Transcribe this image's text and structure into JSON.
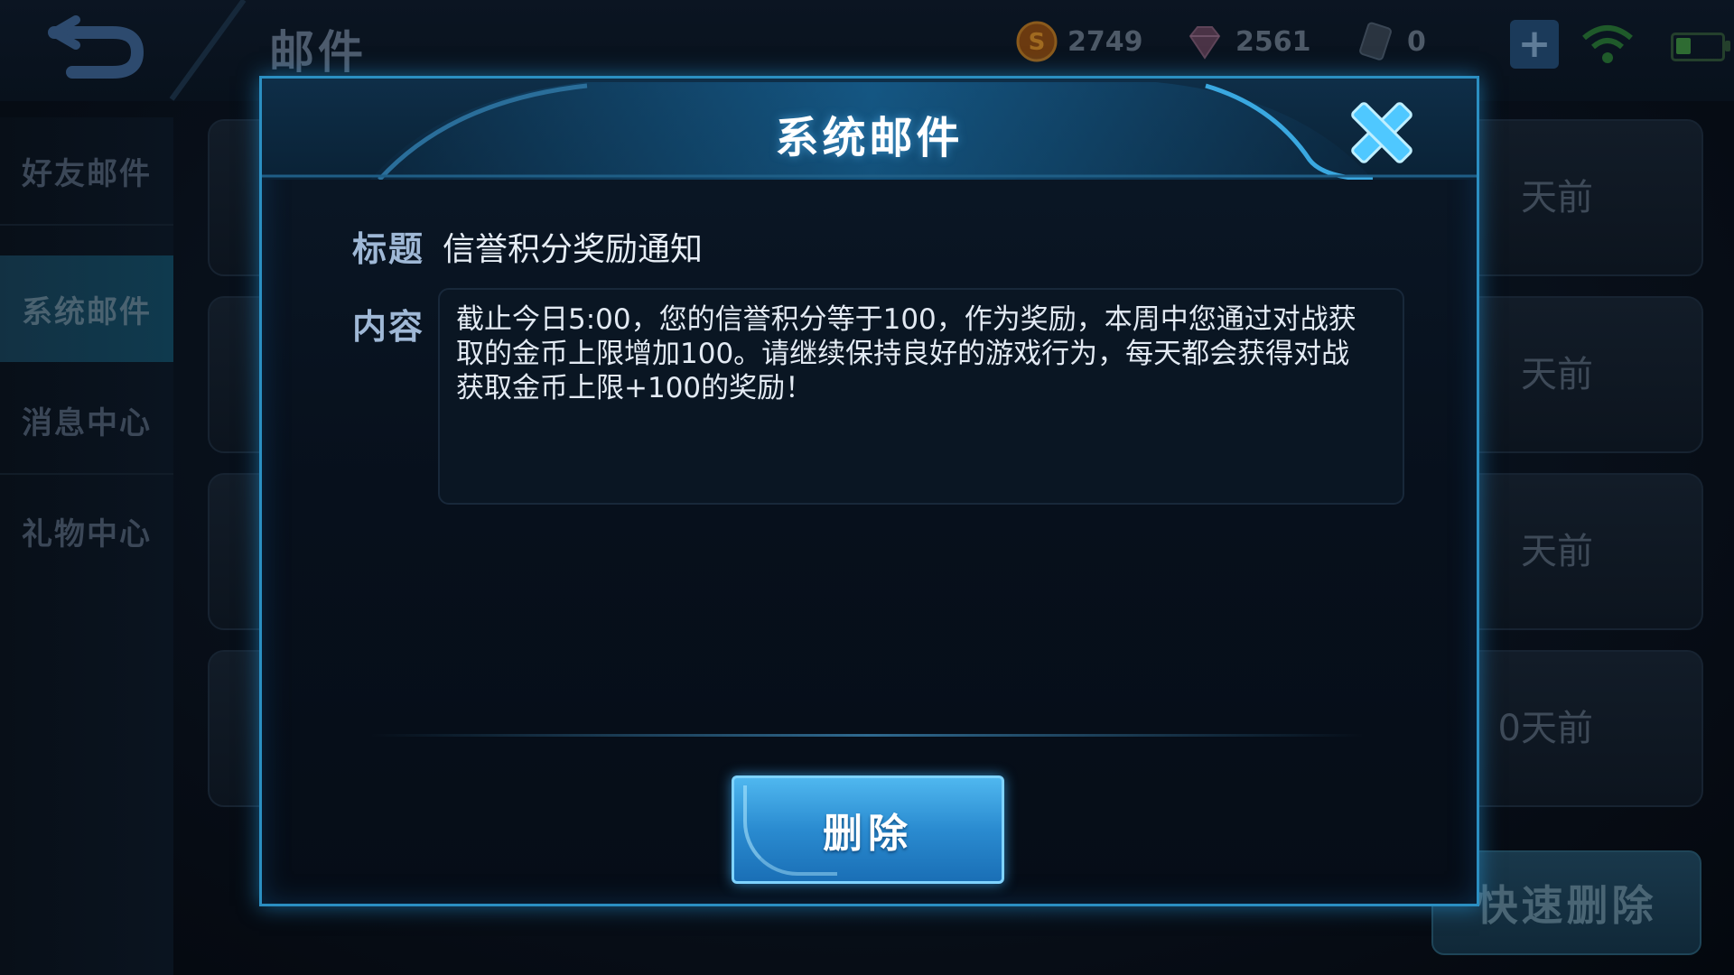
{
  "header": {
    "back_icon": "back-arrow-icon",
    "title": "邮件",
    "gold": "2749",
    "diamonds": "2561",
    "tickets": "0",
    "plus_symbol": "+"
  },
  "sidebar": {
    "items": [
      {
        "label": "好友邮件",
        "active": false
      },
      {
        "label": "系统邮件",
        "active": true
      },
      {
        "label": "消息中心",
        "active": false
      },
      {
        "label": "礼物中心",
        "active": false
      }
    ]
  },
  "mail_list": {
    "times": [
      "天前",
      "天前",
      "天前",
      "0天前"
    ],
    "quick_delete_label": "快速删除"
  },
  "modal": {
    "title": "系统邮件",
    "subject_label": "标题",
    "subject": "信誉积分奖励通知",
    "content_label": "内容",
    "content": "截止今日5:00，您的信誉积分等于100，作为奖励，本周中您通过对战获取的金币上限增加100。请继续保持良好的游戏行为，每天都会获得对战获取金币上限+100的奖励！",
    "delete_label": "删除"
  },
  "colors": {
    "accent": "#2b8fc2",
    "button": "#2a8bd0",
    "close_icon": "#4fc8ff"
  }
}
